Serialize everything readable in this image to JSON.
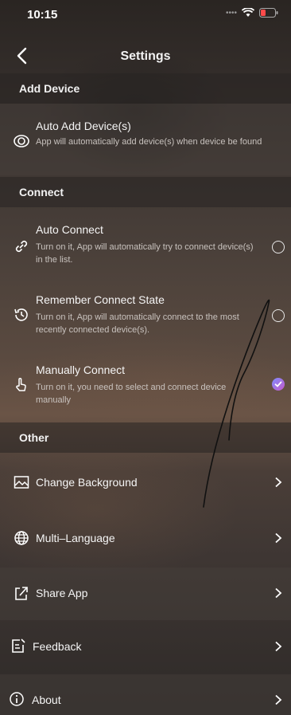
{
  "status": {
    "time": "10:15"
  },
  "header": {
    "title": "Settings"
  },
  "sections": {
    "add_device": "Add Device",
    "connect": "Connect",
    "other": "Other"
  },
  "auto_add": {
    "title": "Auto Add Device(s)",
    "desc": "App will automatically add device(s) when device be found"
  },
  "auto_connect": {
    "title": "Auto Connect",
    "desc": "Turn on it, App will automatically try to connect device(s) in the list.",
    "selected": false
  },
  "remember": {
    "title": "Remember Connect State",
    "desc": "Turn on it, App will automatically connect to the most recently connected device(s).",
    "selected": false
  },
  "manual": {
    "title": "Manually Connect",
    "desc": "Turn on it, you need to select and connect device manually",
    "selected": true
  },
  "other_items": [
    {
      "label": "Change Background",
      "icon": "image-icon"
    },
    {
      "label": "Multi–Language",
      "icon": "globe-icon"
    },
    {
      "label": "Share App",
      "icon": "share-icon"
    },
    {
      "label": "Feedback",
      "icon": "feedback-icon"
    },
    {
      "label": "About",
      "icon": "info-icon"
    }
  ],
  "accent_color": "#8f7df0"
}
